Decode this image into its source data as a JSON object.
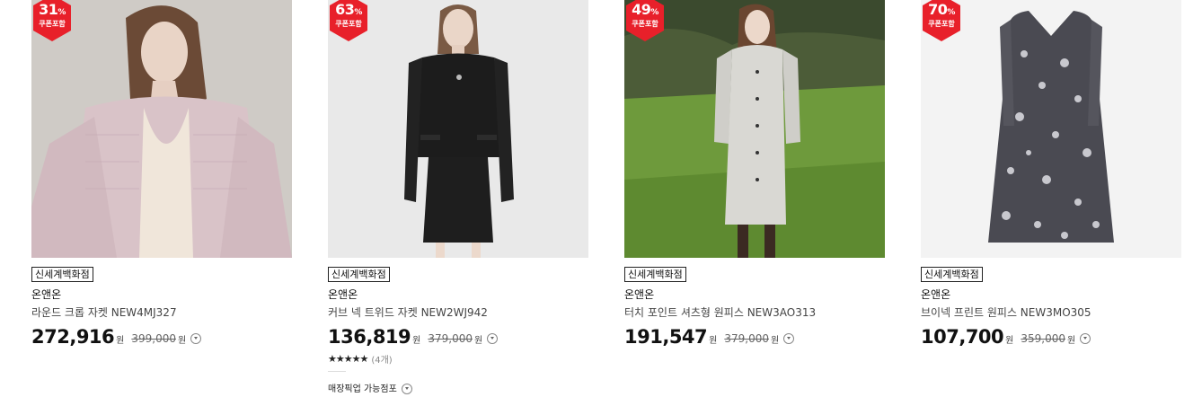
{
  "products": [
    {
      "discount": "31",
      "percent_sign": "%",
      "coupon_label": "쿠폰포함",
      "store_tag": "신세계백화점",
      "brand": "온앤온",
      "name": "라운드 크롭 자켓 NEW4MJ327",
      "price": "272,916",
      "currency": "원",
      "original_price": "399,000",
      "original_currency": "원"
    },
    {
      "discount": "63",
      "percent_sign": "%",
      "coupon_label": "쿠폰포함",
      "store_tag": "신세계백화점",
      "brand": "온앤온",
      "name": "커브 넥 트위드 자켓 NEW2WJ942",
      "price": "136,819",
      "currency": "원",
      "original_price": "379,000",
      "original_currency": "원",
      "rating_stars": "★★★★★",
      "review_count": "(4개)",
      "pickup_label": "매장픽업 가능점포"
    },
    {
      "discount": "49",
      "percent_sign": "%",
      "coupon_label": "쿠폰포함",
      "store_tag": "신세계백화점",
      "brand": "온앤온",
      "name": "터치 포인트 셔츠형 원피스 NEW3AO313",
      "price": "191,547",
      "currency": "원",
      "original_price": "379,000",
      "original_currency": "원"
    },
    {
      "discount": "70",
      "percent_sign": "%",
      "coupon_label": "쿠폰포함",
      "store_tag": "신세계백화점",
      "brand": "온앤온",
      "name": "브이넥 프린트 원피스 NEW3MO305",
      "price": "107,700",
      "currency": "원",
      "original_price": "359,000",
      "original_currency": "원"
    }
  ],
  "colors": {
    "badge": "#e8202a",
    "text": "#111111"
  }
}
